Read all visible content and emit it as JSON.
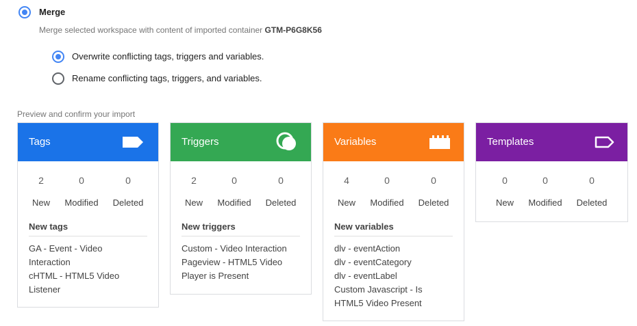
{
  "merge": {
    "label": "Merge",
    "description": "Merge selected workspace with content of imported container",
    "container_id": "GTM-P6G8K56",
    "options": [
      {
        "label": "Overwrite conflicting tags, triggers and variables.",
        "selected": true
      },
      {
        "label": "Rename conflicting tags, triggers, and variables.",
        "selected": false
      }
    ]
  },
  "preview_label": "Preview and confirm your import",
  "cards": [
    {
      "title": "Tags",
      "color": "#1a73e8",
      "icon": "tag-icon",
      "stats": {
        "new": "2",
        "modified": "0",
        "deleted": "0"
      },
      "list_title": "New tags",
      "items": [
        "GA - Event - Video",
        "Interaction",
        "cHTML - HTML5 Video",
        "Listener"
      ]
    },
    {
      "title": "Triggers",
      "color": "#34a853",
      "icon": "trigger-icon",
      "stats": {
        "new": "2",
        "modified": "0",
        "deleted": "0"
      },
      "list_title": "New triggers",
      "items": [
        "Custom - Video Interaction",
        "Pageview - HTML5 Video",
        "Player is Present"
      ]
    },
    {
      "title": "Variables",
      "color": "#fa7b17",
      "icon": "variable-icon",
      "stats": {
        "new": "4",
        "modified": "0",
        "deleted": "0"
      },
      "list_title": "New variables",
      "items": [
        "dlv - eventAction",
        "dlv - eventCategory",
        "dlv - eventLabel",
        "Custom Javascript - Is",
        "HTML5 Video Present"
      ]
    },
    {
      "title": "Templates",
      "color": "#7b1fa2",
      "icon": "template-icon",
      "stats": {
        "new": "0",
        "modified": "0",
        "deleted": "0"
      }
    }
  ],
  "stat_labels": {
    "new": "New",
    "modified": "Modified",
    "deleted": "Deleted"
  }
}
